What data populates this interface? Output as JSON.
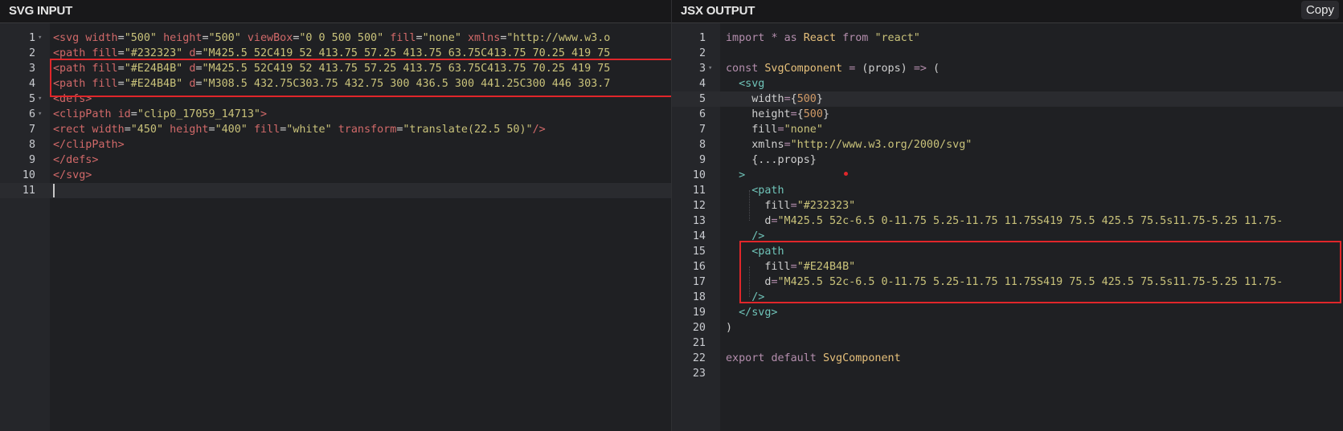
{
  "left_panel": {
    "title": "SVG INPUT",
    "active_line": 11,
    "lines": [
      {
        "n": "1",
        "fold": true,
        "tokens": [
          [
            "tg",
            "<svg"
          ],
          [
            "pl",
            " "
          ],
          [
            "at",
            "width"
          ],
          [
            "pl",
            "="
          ],
          [
            "st",
            "\"500\""
          ],
          [
            "pl",
            " "
          ],
          [
            "at",
            "height"
          ],
          [
            "pl",
            "="
          ],
          [
            "st",
            "\"500\""
          ],
          [
            "pl",
            " "
          ],
          [
            "at",
            "viewBox"
          ],
          [
            "pl",
            "="
          ],
          [
            "st",
            "\"0 0 500 500\""
          ],
          [
            "pl",
            " "
          ],
          [
            "at",
            "fill"
          ],
          [
            "pl",
            "="
          ],
          [
            "st",
            "\"none\""
          ],
          [
            "pl",
            " "
          ],
          [
            "at",
            "xmlns"
          ],
          [
            "pl",
            "="
          ],
          [
            "st",
            "\"http://www.w3.o"
          ]
        ]
      },
      {
        "n": "2",
        "tokens": [
          [
            "tg",
            "<path"
          ],
          [
            "pl",
            " "
          ],
          [
            "at",
            "fill"
          ],
          [
            "pl",
            "="
          ],
          [
            "st",
            "\"#232323\""
          ],
          [
            "pl",
            " "
          ],
          [
            "at",
            "d"
          ],
          [
            "pl",
            "="
          ],
          [
            "st",
            "\"M425.5 52C419 52 413.75 57.25 413.75 63.75C413.75 70.25 419 75"
          ]
        ]
      },
      {
        "n": "3",
        "tokens": [
          [
            "tg",
            "<path"
          ],
          [
            "pl",
            " "
          ],
          [
            "at",
            "fill"
          ],
          [
            "pl",
            "="
          ],
          [
            "st",
            "\"#E24B4B\""
          ],
          [
            "pl",
            " "
          ],
          [
            "at",
            "d"
          ],
          [
            "pl",
            "="
          ],
          [
            "st",
            "\"M425.5 52C419 52 413.75 57.25 413.75 63.75C413.75 70.25 419 75"
          ]
        ]
      },
      {
        "n": "4",
        "tokens": [
          [
            "tg",
            "<path"
          ],
          [
            "pl",
            " "
          ],
          [
            "at",
            "fill"
          ],
          [
            "pl",
            "="
          ],
          [
            "st",
            "\"#E24B4B\""
          ],
          [
            "pl",
            " "
          ],
          [
            "at",
            "d"
          ],
          [
            "pl",
            "="
          ],
          [
            "st",
            "\"M308.5 432.75C303.75 432.75 300 436.5 300 441.25C300 446 303.7"
          ]
        ]
      },
      {
        "n": "5",
        "fold": true,
        "tokens": [
          [
            "tg",
            "<defs>"
          ]
        ]
      },
      {
        "n": "6",
        "fold": true,
        "tokens": [
          [
            "tg",
            "<clipPath"
          ],
          [
            "pl",
            " "
          ],
          [
            "at",
            "id"
          ],
          [
            "pl",
            "="
          ],
          [
            "st",
            "\"clip0_17059_14713\""
          ],
          [
            "tg",
            ">"
          ]
        ]
      },
      {
        "n": "7",
        "tokens": [
          [
            "tg",
            "<rect"
          ],
          [
            "pl",
            " "
          ],
          [
            "at",
            "width"
          ],
          [
            "pl",
            "="
          ],
          [
            "st",
            "\"450\""
          ],
          [
            "pl",
            " "
          ],
          [
            "at",
            "height"
          ],
          [
            "pl",
            "="
          ],
          [
            "st",
            "\"400\""
          ],
          [
            "pl",
            " "
          ],
          [
            "at",
            "fill"
          ],
          [
            "pl",
            "="
          ],
          [
            "st",
            "\"white\""
          ],
          [
            "pl",
            " "
          ],
          [
            "at",
            "transform"
          ],
          [
            "pl",
            "="
          ],
          [
            "st",
            "\"translate(22.5 50)\""
          ],
          [
            "tg",
            "/>"
          ]
        ]
      },
      {
        "n": "8",
        "tokens": [
          [
            "tg",
            "</clipPath>"
          ]
        ]
      },
      {
        "n": "9",
        "tokens": [
          [
            "tg",
            "</defs>"
          ]
        ]
      },
      {
        "n": "10",
        "tokens": [
          [
            "tg",
            "</svg>"
          ]
        ]
      },
      {
        "n": "11",
        "tokens": []
      }
    ]
  },
  "right_panel": {
    "title": "JSX OUTPUT",
    "copy_label": "Copy",
    "active_line": 5,
    "lines": [
      {
        "n": "1",
        "tokens": [
          [
            "kw",
            "import"
          ],
          [
            "pn",
            " "
          ],
          [
            "kw",
            "*"
          ],
          [
            "pn",
            " "
          ],
          [
            "kw",
            "as"
          ],
          [
            "pn",
            " "
          ],
          [
            "id",
            "React"
          ],
          [
            "pn",
            " "
          ],
          [
            "kw",
            "from"
          ],
          [
            "pn",
            " "
          ],
          [
            "st",
            "\"react\""
          ]
        ]
      },
      {
        "n": "2",
        "tokens": []
      },
      {
        "n": "3",
        "fold": true,
        "tokens": [
          [
            "kw",
            "const"
          ],
          [
            "pn",
            " "
          ],
          [
            "id",
            "SvgComponent"
          ],
          [
            "pn",
            " "
          ],
          [
            "kw",
            "="
          ],
          [
            "pn",
            " (props) "
          ],
          [
            "kw",
            "=>"
          ],
          [
            "pn",
            " ("
          ]
        ]
      },
      {
        "n": "4",
        "tokens": [
          [
            "pn",
            "  "
          ],
          [
            "jx",
            "<svg"
          ]
        ]
      },
      {
        "n": "5",
        "tokens": [
          [
            "pn",
            "    "
          ],
          [
            "jat",
            "width"
          ],
          [
            "kw",
            "="
          ],
          [
            "pn",
            "{"
          ],
          [
            "nm",
            "500"
          ],
          [
            "pn",
            "}"
          ]
        ]
      },
      {
        "n": "6",
        "tokens": [
          [
            "pn",
            "    "
          ],
          [
            "jat",
            "height"
          ],
          [
            "kw",
            "="
          ],
          [
            "pn",
            "{"
          ],
          [
            "nm",
            "500"
          ],
          [
            "pn",
            "}"
          ]
        ]
      },
      {
        "n": "7",
        "tokens": [
          [
            "pn",
            "    "
          ],
          [
            "jat",
            "fill"
          ],
          [
            "kw",
            "="
          ],
          [
            "st",
            "\"none\""
          ]
        ]
      },
      {
        "n": "8",
        "tokens": [
          [
            "pn",
            "    "
          ],
          [
            "jat",
            "xmlns"
          ],
          [
            "kw",
            "="
          ],
          [
            "st",
            "\"http://www.w3.org/2000/svg\""
          ]
        ]
      },
      {
        "n": "9",
        "tokens": [
          [
            "pn",
            "    {...props}"
          ]
        ]
      },
      {
        "n": "10",
        "tokens": [
          [
            "pn",
            "  "
          ],
          [
            "jx",
            ">"
          ]
        ]
      },
      {
        "n": "11",
        "tokens": [
          [
            "pn",
            "    "
          ],
          [
            "jx",
            "<path"
          ]
        ]
      },
      {
        "n": "12",
        "tokens": [
          [
            "pn",
            "      "
          ],
          [
            "jat",
            "fill"
          ],
          [
            "kw",
            "="
          ],
          [
            "st",
            "\"#232323\""
          ]
        ]
      },
      {
        "n": "13",
        "tokens": [
          [
            "pn",
            "      "
          ],
          [
            "jat",
            "d"
          ],
          [
            "kw",
            "="
          ],
          [
            "st",
            "\"M425.5 52c-6.5 0-11.75 5.25-11.75 11.75S419 75.5 425.5 75.5s11.75-5.25 11.75-"
          ]
        ]
      },
      {
        "n": "14",
        "tokens": [
          [
            "pn",
            "    "
          ],
          [
            "jx",
            "/>"
          ]
        ]
      },
      {
        "n": "15",
        "tokens": [
          [
            "pn",
            "    "
          ],
          [
            "jx",
            "<path"
          ]
        ]
      },
      {
        "n": "16",
        "tokens": [
          [
            "pn",
            "      "
          ],
          [
            "jat",
            "fill"
          ],
          [
            "kw",
            "="
          ],
          [
            "st",
            "\"#E24B4B\""
          ]
        ]
      },
      {
        "n": "17",
        "tokens": [
          [
            "pn",
            "      "
          ],
          [
            "jat",
            "d"
          ],
          [
            "kw",
            "="
          ],
          [
            "st",
            "\"M425.5 52c-6.5 0-11.75 5.25-11.75 11.75S419 75.5 425.5 75.5s11.75-5.25 11.75-"
          ]
        ]
      },
      {
        "n": "18",
        "tokens": [
          [
            "pn",
            "    "
          ],
          [
            "jx",
            "/>"
          ]
        ]
      },
      {
        "n": "19",
        "tokens": [
          [
            "pn",
            "  "
          ],
          [
            "jx",
            "</svg>"
          ]
        ]
      },
      {
        "n": "20",
        "tokens": [
          [
            "pn",
            ")"
          ]
        ]
      },
      {
        "n": "21",
        "tokens": []
      },
      {
        "n": "22",
        "tokens": [
          [
            "kw",
            "export"
          ],
          [
            "pn",
            " "
          ],
          [
            "kw",
            "default"
          ],
          [
            "pn",
            " "
          ],
          [
            "id",
            "SvgComponent"
          ]
        ]
      },
      {
        "n": "23",
        "tokens": []
      }
    ]
  },
  "colors": {
    "highlight_box": "#E0262A",
    "background": "#1F2023",
    "header": "#18181A"
  }
}
